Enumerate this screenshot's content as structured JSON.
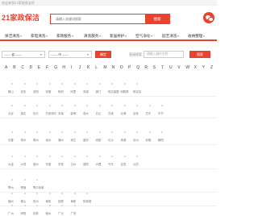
{
  "topbar": {
    "text": "欢迎来到21家政保洁网"
  },
  "header": {
    "logo": "21家政保洁",
    "search_placeholder": "请输入关键词搜索",
    "search_button": "搜索"
  },
  "nav": {
    "items": [
      {
        "label": "保洁清洗"
      },
      {
        "label": "家电清洗"
      },
      {
        "label": "家政服务"
      },
      {
        "label": "清洗服务"
      },
      {
        "label": "家居养护"
      },
      {
        "label": "空气净化"
      },
      {
        "label": "园艺清洗"
      },
      {
        "label": "收纳整理"
      }
    ]
  },
  "filter": {
    "province_select": "—— 省 ——",
    "city_select": "—— 市 ——",
    "confirm_button": "确定",
    "direct_label": "直接搜索：",
    "direct_placeholder": "请输入城市名称",
    "search_button": "搜索"
  },
  "alphabet": [
    "A",
    "B",
    "C",
    "D",
    "E",
    "F",
    "G",
    "H",
    "I",
    "J",
    "K",
    "L",
    "M",
    "N",
    "O",
    "P",
    "Q",
    "R",
    "S",
    "T",
    "U",
    "V",
    "W",
    "X",
    "Y",
    "Z"
  ],
  "city_rows": [
    [
      "鞍山",
      "安庆",
      "安阳",
      "安顺",
      "阿坝",
      "阿里",
      "安康",
      "澳门",
      "阿拉善盟",
      "阿勒泰",
      "阿克苏"
    ],
    [
      "北京",
      "保定",
      "包头",
      "巴彦淖尔",
      "本溪",
      "蚌埠",
      "亳州",
      "白山",
      "白城",
      "北海",
      "百色",
      "巴中",
      "毕节"
    ],
    [
      "长春",
      "常州",
      "滁州",
      "池州",
      "潮州",
      "崇左",
      "重庆",
      "成都",
      "长沙",
      "承德",
      "沧州",
      "赤峰",
      "朝阳"
    ],
    [
      "大连",
      "大同",
      "德州",
      "东营",
      "东莞",
      "达州",
      "德阳",
      "大理",
      "丹东",
      "定西",
      "大庆"
    ],
    [
      "鄂州",
      "恩施",
      "鄂尔多斯"
    ],
    [
      "福州",
      "佛山",
      "抚州",
      "阜阳",
      "抚顺",
      "阜新",
      "防城港"
    ],
    [
      "广州",
      "贵阳",
      "桂林",
      "赣州",
      "广元",
      "广安"
    ]
  ]
}
